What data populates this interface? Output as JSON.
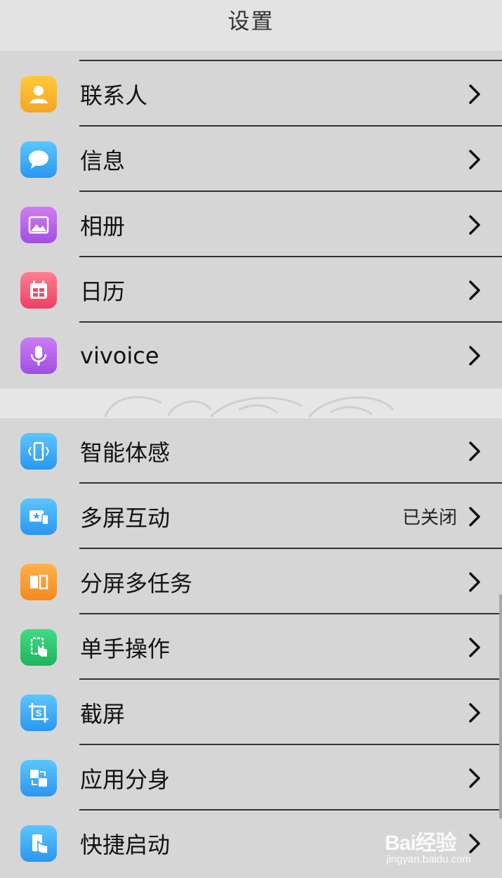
{
  "header": {
    "title": "设置"
  },
  "group1": [
    {
      "label": "联系人",
      "icon": "contacts-icon",
      "color": "#f5a623"
    },
    {
      "label": "信息",
      "icon": "message-icon",
      "color": "#3aa0f3"
    },
    {
      "label": "相册",
      "icon": "gallery-icon",
      "color": "#b85ce8"
    },
    {
      "label": "日历",
      "icon": "calendar-icon",
      "color": "#f0506e"
    },
    {
      "label": "vivoice",
      "icon": "microphone-icon",
      "color": "#b35ce6"
    }
  ],
  "group2": [
    {
      "label": "智能体感",
      "icon": "motion-phone-icon",
      "color": "#3aa0f3"
    },
    {
      "label": "多屏互动",
      "icon": "multiscreen-icon",
      "color": "#3aa0f3",
      "status": "已关闭"
    },
    {
      "label": "分屏多任务",
      "icon": "split-screen-icon",
      "color": "#f59b23"
    },
    {
      "label": "单手操作",
      "icon": "one-hand-icon",
      "color": "#27c46b"
    },
    {
      "label": "截屏",
      "icon": "screenshot-icon",
      "color": "#3aa0f3"
    },
    {
      "label": "应用分身",
      "icon": "app-clone-icon",
      "color": "#3aa0f3"
    },
    {
      "label": "快捷启动",
      "icon": "quick-launch-icon",
      "color": "#3aa0f3"
    }
  ],
  "watermark": {
    "brand": "Bai经验",
    "url": "jingyan.baidu.com"
  }
}
